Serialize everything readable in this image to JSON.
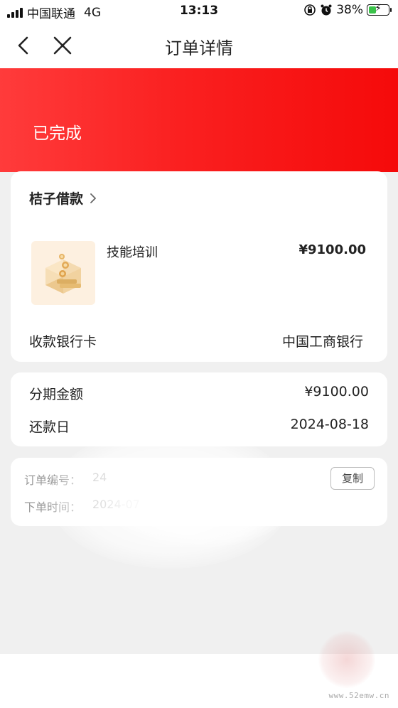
{
  "status_bar": {
    "carrier": "中国联通",
    "network": "4G",
    "time": "13:13",
    "battery": "38%",
    "battery_level": 0.38
  },
  "nav": {
    "title": "订单详情"
  },
  "order": {
    "status": "已完成",
    "merchant": "桔子借款",
    "product_name": "技能培训",
    "product_price": "¥9100.00",
    "bank_label": "收款银行卡",
    "bank_value": "中国工商银行"
  },
  "installment": {
    "amount_label": "分期金额",
    "amount_value": "¥9100.00",
    "due_label": "还款日",
    "due_value": "2024-08-18"
  },
  "order_info": {
    "number_label": "订单编号：",
    "number_value": "24",
    "time_label": "下单时间：",
    "time_value": "2024-07",
    "copy_label": "复制"
  },
  "watermark": {
    "text": "www.52emw.cn"
  },
  "colors": {
    "header_red": "#f7141a",
    "battery_green": "#3ac34a"
  }
}
